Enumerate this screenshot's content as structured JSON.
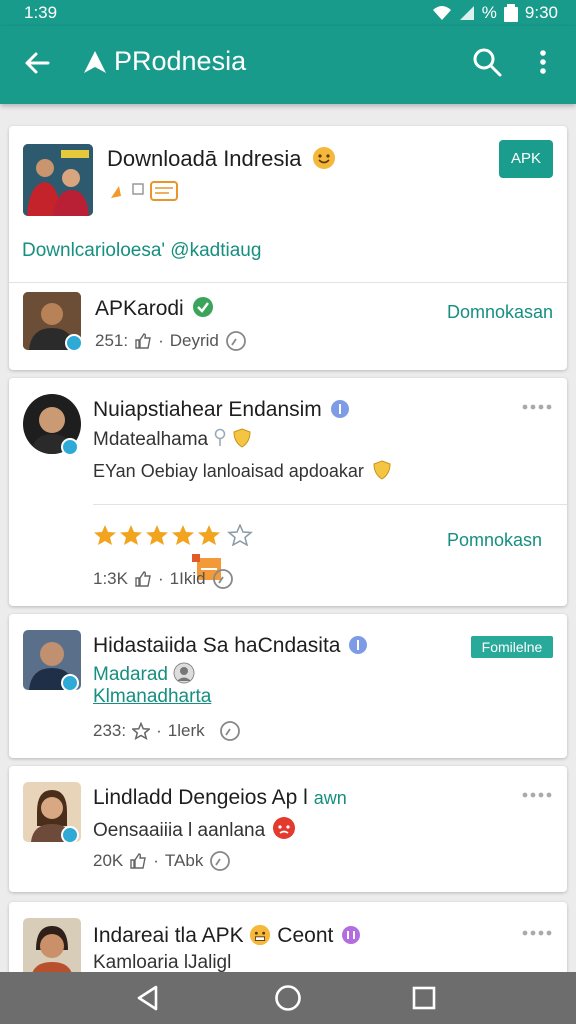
{
  "status_bar": {
    "time": "1:39",
    "right_text": "9:30",
    "percent_sign": "%"
  },
  "app_bar": {
    "title": "PRodnesia"
  },
  "featured": {
    "title": "Downloadā Indresia",
    "apk_button": "APK",
    "link_text": "Downlcarioloesa' @kadtiaug",
    "item": {
      "name": "APKarodi",
      "meta_count": "251:",
      "meta_text": "Deyrid",
      "action": "Domnokasan"
    }
  },
  "posts": [
    {
      "name": "Nuiapstiahear Endansim",
      "subtitle": "Mdatealhama",
      "body": "EYan Oebiay lanloaisad apdoakar",
      "rating": 5,
      "action": "Pomnokasn",
      "meta_count": "1:3K",
      "meta_text": "1Ikid"
    },
    {
      "name": "Hidastaiida Sa haCndasita",
      "subtitle": "Madarad",
      "link": "Klmanadharta",
      "badge": "Fomilelne",
      "meta_count": "233:",
      "meta_text": "1lerk"
    },
    {
      "name": "Lindladd Dengeios Ap l",
      "name_suffix": "awn",
      "subtitle": "Oensaaiiia l aanlana",
      "meta_count": "20K",
      "meta_text": "TAbk"
    },
    {
      "name": "Indareai tla APK",
      "name_suffix": "Ceont",
      "subtitle": "Kamloaria lJaligl"
    }
  ],
  "colors": {
    "primary": "#199b8c",
    "accent_link": "#168f80",
    "star": "#f2a41e",
    "verified": "#6f8fe0"
  }
}
